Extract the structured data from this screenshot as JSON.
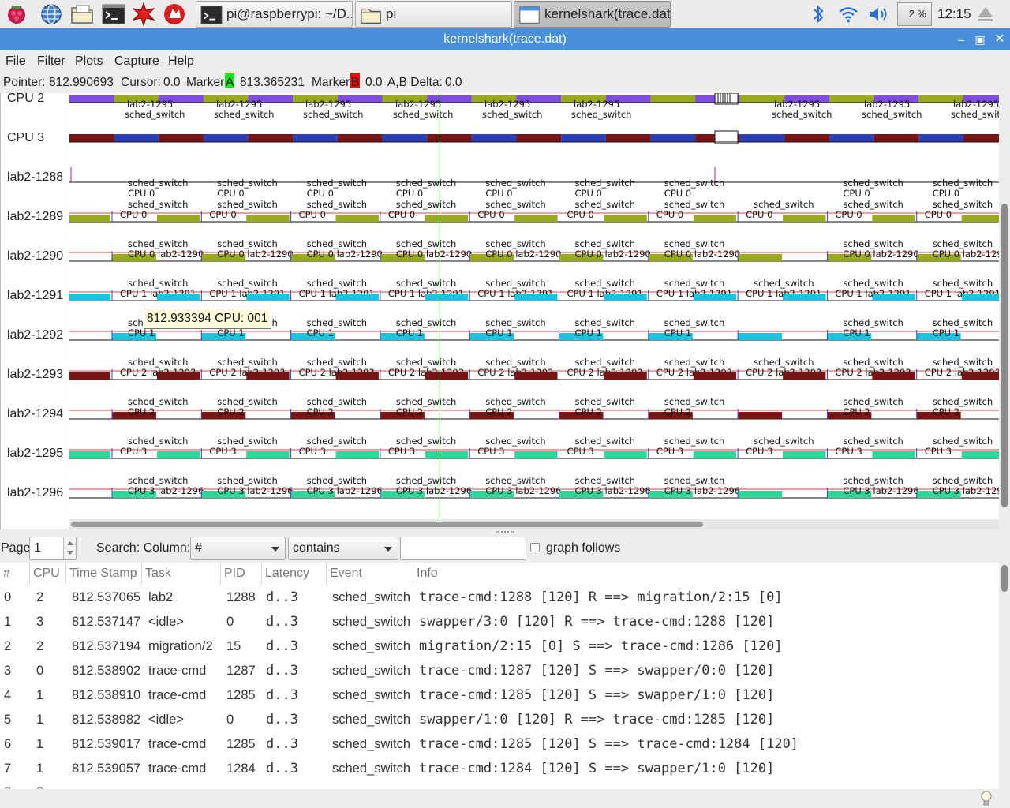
{
  "taskbar": {
    "launchers": [
      "raspberry-menu",
      "web-browser",
      "file-manager",
      "terminal",
      "mathematica",
      "wolfram"
    ],
    "buttons": [
      {
        "label": "pi@raspberrypi: ~/D...",
        "icon": "terminal-icon",
        "active": false
      },
      {
        "label": "pi",
        "icon": "folder-icon",
        "active": false
      },
      {
        "label": "kernelshark(trace.dat)",
        "icon": "window-icon",
        "active": true
      }
    ],
    "cpu_usage": "2 %",
    "clock": "12:15"
  },
  "window": {
    "title": "kernelshark(trace.dat)"
  },
  "menu": [
    "File",
    "Filter",
    "Plots",
    "Capture",
    "Help"
  ],
  "info": {
    "pointer_label": "Pointer:",
    "pointer_value": "812.990693",
    "cursor_label": "Cursor:",
    "cursor_value": "0.0",
    "marker_a_label": "Marker",
    "marker_a_letter": "A",
    "marker_a_value": "813.365231",
    "marker_b_label": "Marker",
    "marker_b_letter": "B",
    "marker_b_value": "0.0",
    "delta_label": "A,B Delta:",
    "delta_value": "0.0",
    "marker_a_color": "#1fe01f",
    "marker_b_color": "#e01010"
  },
  "plot": {
    "rows": [
      "CPU 2",
      "CPU 3",
      "lab2-1288",
      "lab2-1289",
      "lab2-1290",
      "lab2-1291",
      "lab2-1292",
      "lab2-1293",
      "lab2-1294",
      "lab2-1295",
      "lab2-1296"
    ],
    "cpu2_task_label": "lab2-1295",
    "event_name": "sched_switch",
    "row_info": {
      "lab2-1289": "CPU 0",
      "lab2-1290": "CPU 0 lab2-1290",
      "lab2-1291": "CPU 1 lab2-1291",
      "lab2-1292": "CPU 1",
      "lab2-1293": "CPU 2 lab2-1293",
      "lab2-1294": "CPU 2",
      "lab2-1295": "CPU 3",
      "lab2-1296": "CPU 3 lab2-1296"
    },
    "colors": {
      "purple": "#7e4ee0",
      "olive": "#9aaa1e",
      "blue": "#2c3fb8",
      "maroon": "#7a1414",
      "cyan": "#1fc3e0",
      "green": "#2fd79a"
    },
    "tooltip": "812.933394 CPU: 001"
  },
  "search": {
    "page_label": "Page",
    "page_value": "1",
    "search_label": "Search: Column:",
    "column_value": "#",
    "mode_value": "contains",
    "query_value": "",
    "graph_follows_label": "graph follows"
  },
  "table": {
    "headers": [
      "#",
      "CPU",
      "Time Stamp",
      "Task",
      "PID",
      "Latency",
      "Event",
      "Info"
    ],
    "rows": [
      {
        "n": "0",
        "cpu": "2",
        "ts": "812.537065",
        "task": "lab2",
        "pid": "1288",
        "lat": "d..3",
        "event": "sched_switch",
        "info": "trace-cmd:1288 [120] R ==> migration/2:15 [0]"
      },
      {
        "n": "1",
        "cpu": "3",
        "ts": "812.537147",
        "task": "<idle>",
        "pid": "0",
        "lat": "d..3",
        "event": "sched_switch",
        "info": "swapper/3:0 [120] R ==> trace-cmd:1288 [120]"
      },
      {
        "n": "2",
        "cpu": "2",
        "ts": "812.537194",
        "task": "migration/2",
        "pid": "15",
        "lat": "d..3",
        "event": "sched_switch",
        "info": "migration/2:15 [0] S ==> trace-cmd:1286 [120]"
      },
      {
        "n": "3",
        "cpu": "0",
        "ts": "812.538902",
        "task": "trace-cmd",
        "pid": "1287",
        "lat": "d..3",
        "event": "sched_switch",
        "info": "trace-cmd:1287 [120] S ==> swapper/0:0 [120]"
      },
      {
        "n": "4",
        "cpu": "1",
        "ts": "812.538910",
        "task": "trace-cmd",
        "pid": "1285",
        "lat": "d..3",
        "event": "sched_switch",
        "info": "trace-cmd:1285 [120] S ==> swapper/1:0 [120]"
      },
      {
        "n": "5",
        "cpu": "1",
        "ts": "812.538982",
        "task": "<idle>",
        "pid": "0",
        "lat": "d..3",
        "event": "sched_switch",
        "info": "swapper/1:0 [120] R ==> trace-cmd:1285 [120]"
      },
      {
        "n": "6",
        "cpu": "1",
        "ts": "812.539017",
        "task": "trace-cmd",
        "pid": "1285",
        "lat": "d..3",
        "event": "sched_switch",
        "info": "trace-cmd:1285 [120] S ==> trace-cmd:1284 [120]"
      },
      {
        "n": "7",
        "cpu": "1",
        "ts": "812.539057",
        "task": "trace-cmd",
        "pid": "1284",
        "lat": "d..3",
        "event": "sched_switch",
        "info": "trace-cmd:1284 [120] S ==> swapper/1:0 [120]"
      }
    ]
  }
}
